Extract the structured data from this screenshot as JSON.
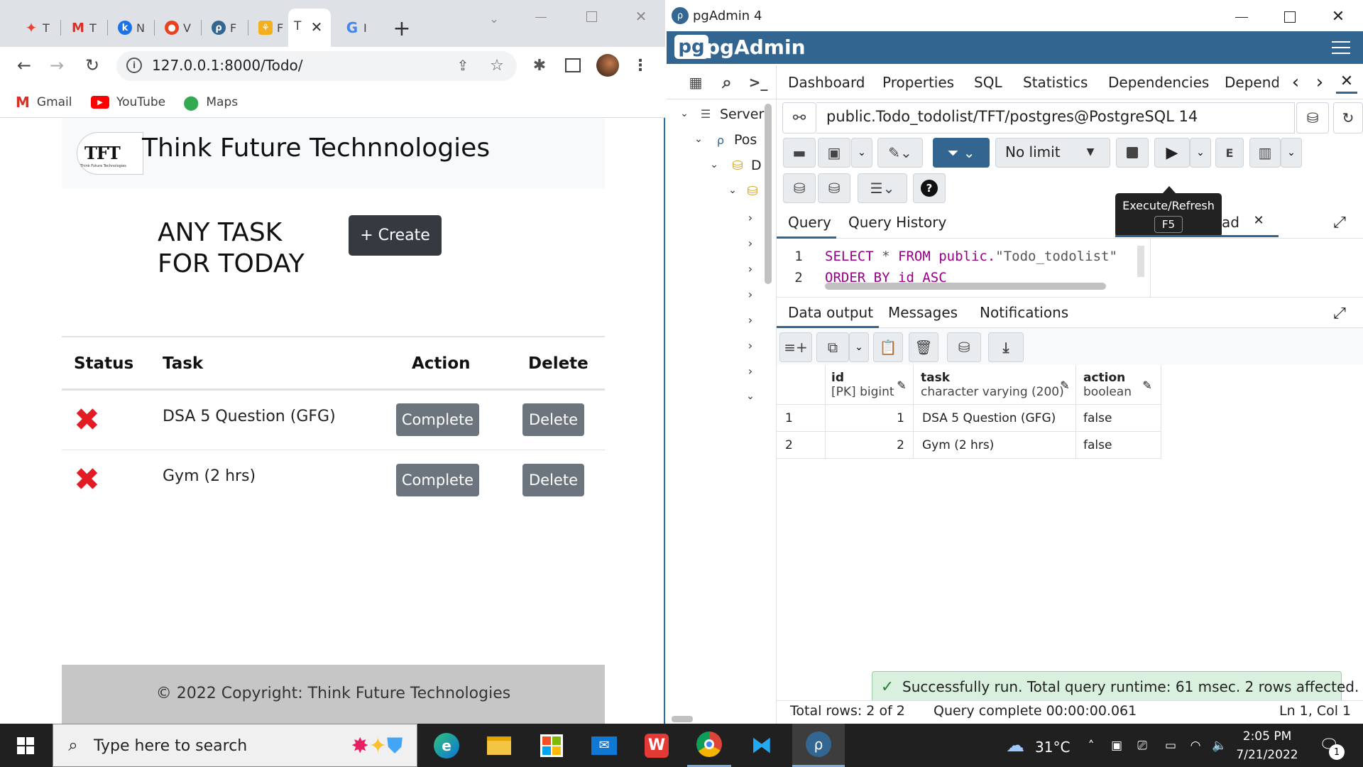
{
  "chrome": {
    "tabs": [
      "T",
      "T",
      "N",
      "V",
      "F",
      "F",
      "T",
      "I"
    ],
    "new_tab": "+",
    "url": "127.0.0.1:8000/Todo/",
    "bookmarks": [
      "Gmail",
      "YouTube",
      "Maps"
    ]
  },
  "page": {
    "brand": "Think Future Technnologies",
    "logo_text": "TFT",
    "logo_sub": "Think Future Technologies",
    "heading_line1": "ANY TASK",
    "heading_line2": "FOR TODAY",
    "create_label": "+ Create",
    "table_headers": [
      "Status",
      "Task",
      "Action",
      "Delete"
    ],
    "rows": [
      {
        "task": "DSA 5 Question (GFG)",
        "status": "✖",
        "action": "Complete",
        "delete": "Delete"
      },
      {
        "task": "Gym (2 hrs)",
        "status": "✖",
        "action": "Complete",
        "delete": "Delete"
      }
    ],
    "footer": "© 2022 Copyright: Think Future Technologies"
  },
  "pgadmin": {
    "title": "pgAdmin 4",
    "brand": "pgAdmin",
    "main_tabs": [
      "Dashboard",
      "Properties",
      "SQL",
      "Statistics",
      "Dependencies",
      "Depend"
    ],
    "tree": [
      "Server",
      "Pos",
      "D"
    ],
    "connection": "public.Todo_todolist/TFT/postgres@PostgreSQL 14",
    "limit": "No limit",
    "tooltip_title": "Execute/Refresh",
    "tooltip_key": "F5",
    "query_tabs": [
      "Query",
      "Query History"
    ],
    "scratch_tab": "ad",
    "sql_line1_kw1": "SELECT",
    "sql_line1_op": "*",
    "sql_line1_kw2": "FROM",
    "sql_line1_schema": "public.",
    "sql_line1_table": "\"Todo_todolist\"",
    "sql_line2_kw1": "ORDER",
    "sql_line2_kw2": "BY",
    "sql_line2_col": "id",
    "sql_line2_kw3": "ASC",
    "line_numbers": [
      "1",
      "2"
    ],
    "output_tabs": [
      "Data output",
      "Messages",
      "Notifications"
    ],
    "columns": [
      {
        "name": "id",
        "type": "[PK] bigint"
      },
      {
        "name": "task",
        "type": "character varying (200)"
      },
      {
        "name": "action",
        "type": "boolean"
      }
    ],
    "rows": [
      {
        "n": "1",
        "id": "1",
        "task": "DSA 5 Question (GFG)",
        "action": "false"
      },
      {
        "n": "2",
        "id": "2",
        "task": "Gym (2 hrs)",
        "action": "false"
      }
    ],
    "toast": "Successfully run. Total query runtime: 61 msec. 2 rows affected.",
    "status_rows": "Total rows: 2 of 2",
    "status_query": "Query complete 00:00:00.061",
    "status_pos": "Ln 1, Col 1"
  },
  "taskbar": {
    "search_placeholder": "Type here to search",
    "temperature": "31°C",
    "time": "2:05 PM",
    "date": "7/21/2022",
    "notifications": "1"
  },
  "colors": {
    "pg_blue": "#326690",
    "filter_blue": "#326690",
    "dark_btn": "#343a40",
    "red_x": "#e31b23",
    "sql_keyword": "#908"
  }
}
